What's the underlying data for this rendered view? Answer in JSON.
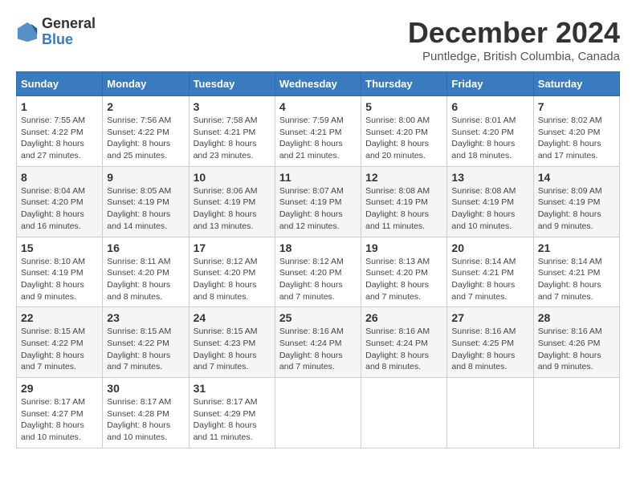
{
  "logo": {
    "general": "General",
    "blue": "Blue"
  },
  "title": "December 2024",
  "location": "Puntledge, British Columbia, Canada",
  "weekdays": [
    "Sunday",
    "Monday",
    "Tuesday",
    "Wednesday",
    "Thursday",
    "Friday",
    "Saturday"
  ],
  "weeks": [
    [
      {
        "day": "1",
        "sunrise": "7:55 AM",
        "sunset": "4:22 PM",
        "daylight": "8 hours and 27 minutes."
      },
      {
        "day": "2",
        "sunrise": "7:56 AM",
        "sunset": "4:22 PM",
        "daylight": "8 hours and 25 minutes."
      },
      {
        "day": "3",
        "sunrise": "7:58 AM",
        "sunset": "4:21 PM",
        "daylight": "8 hours and 23 minutes."
      },
      {
        "day": "4",
        "sunrise": "7:59 AM",
        "sunset": "4:21 PM",
        "daylight": "8 hours and 21 minutes."
      },
      {
        "day": "5",
        "sunrise": "8:00 AM",
        "sunset": "4:20 PM",
        "daylight": "8 hours and 20 minutes."
      },
      {
        "day": "6",
        "sunrise": "8:01 AM",
        "sunset": "4:20 PM",
        "daylight": "8 hours and 18 minutes."
      },
      {
        "day": "7",
        "sunrise": "8:02 AM",
        "sunset": "4:20 PM",
        "daylight": "8 hours and 17 minutes."
      }
    ],
    [
      {
        "day": "8",
        "sunrise": "8:04 AM",
        "sunset": "4:20 PM",
        "daylight": "8 hours and 16 minutes."
      },
      {
        "day": "9",
        "sunrise": "8:05 AM",
        "sunset": "4:19 PM",
        "daylight": "8 hours and 14 minutes."
      },
      {
        "day": "10",
        "sunrise": "8:06 AM",
        "sunset": "4:19 PM",
        "daylight": "8 hours and 13 minutes."
      },
      {
        "day": "11",
        "sunrise": "8:07 AM",
        "sunset": "4:19 PM",
        "daylight": "8 hours and 12 minutes."
      },
      {
        "day": "12",
        "sunrise": "8:08 AM",
        "sunset": "4:19 PM",
        "daylight": "8 hours and 11 minutes."
      },
      {
        "day": "13",
        "sunrise": "8:08 AM",
        "sunset": "4:19 PM",
        "daylight": "8 hours and 10 minutes."
      },
      {
        "day": "14",
        "sunrise": "8:09 AM",
        "sunset": "4:19 PM",
        "daylight": "8 hours and 9 minutes."
      }
    ],
    [
      {
        "day": "15",
        "sunrise": "8:10 AM",
        "sunset": "4:19 PM",
        "daylight": "8 hours and 9 minutes."
      },
      {
        "day": "16",
        "sunrise": "8:11 AM",
        "sunset": "4:20 PM",
        "daylight": "8 hours and 8 minutes."
      },
      {
        "day": "17",
        "sunrise": "8:12 AM",
        "sunset": "4:20 PM",
        "daylight": "8 hours and 8 minutes."
      },
      {
        "day": "18",
        "sunrise": "8:12 AM",
        "sunset": "4:20 PM",
        "daylight": "8 hours and 7 minutes."
      },
      {
        "day": "19",
        "sunrise": "8:13 AM",
        "sunset": "4:20 PM",
        "daylight": "8 hours and 7 minutes."
      },
      {
        "day": "20",
        "sunrise": "8:14 AM",
        "sunset": "4:21 PM",
        "daylight": "8 hours and 7 minutes."
      },
      {
        "day": "21",
        "sunrise": "8:14 AM",
        "sunset": "4:21 PM",
        "daylight": "8 hours and 7 minutes."
      }
    ],
    [
      {
        "day": "22",
        "sunrise": "8:15 AM",
        "sunset": "4:22 PM",
        "daylight": "8 hours and 7 minutes."
      },
      {
        "day": "23",
        "sunrise": "8:15 AM",
        "sunset": "4:22 PM",
        "daylight": "8 hours and 7 minutes."
      },
      {
        "day": "24",
        "sunrise": "8:15 AM",
        "sunset": "4:23 PM",
        "daylight": "8 hours and 7 minutes."
      },
      {
        "day": "25",
        "sunrise": "8:16 AM",
        "sunset": "4:24 PM",
        "daylight": "8 hours and 7 minutes."
      },
      {
        "day": "26",
        "sunrise": "8:16 AM",
        "sunset": "4:24 PM",
        "daylight": "8 hours and 8 minutes."
      },
      {
        "day": "27",
        "sunrise": "8:16 AM",
        "sunset": "4:25 PM",
        "daylight": "8 hours and 8 minutes."
      },
      {
        "day": "28",
        "sunrise": "8:16 AM",
        "sunset": "4:26 PM",
        "daylight": "8 hours and 9 minutes."
      }
    ],
    [
      {
        "day": "29",
        "sunrise": "8:17 AM",
        "sunset": "4:27 PM",
        "daylight": "8 hours and 10 minutes."
      },
      {
        "day": "30",
        "sunrise": "8:17 AM",
        "sunset": "4:28 PM",
        "daylight": "8 hours and 10 minutes."
      },
      {
        "day": "31",
        "sunrise": "8:17 AM",
        "sunset": "4:29 PM",
        "daylight": "8 hours and 11 minutes."
      },
      null,
      null,
      null,
      null
    ]
  ],
  "labels": {
    "sunrise": "Sunrise:",
    "sunset": "Sunset:",
    "daylight": "Daylight:"
  }
}
